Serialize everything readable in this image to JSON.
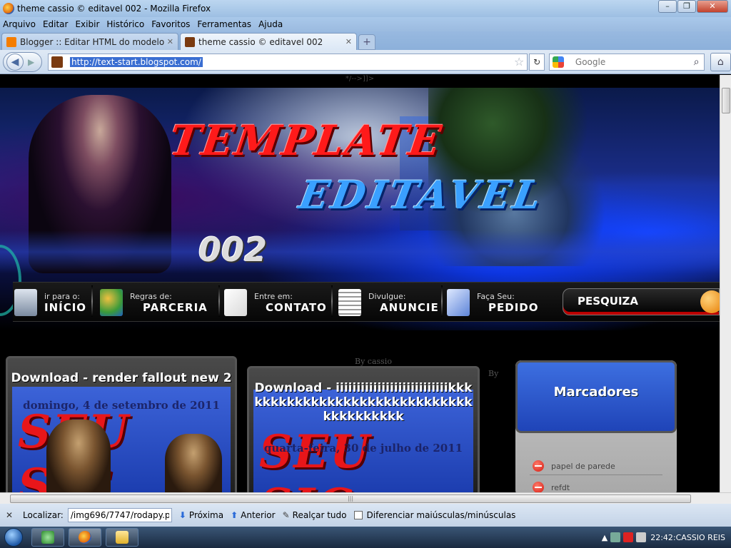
{
  "window": {
    "title": "theme cassio © editavel 002 - Mozilla Firefox"
  },
  "menu": [
    "Arquivo",
    "Editar",
    "Exibir",
    "Histórico",
    "Favoritos",
    "Ferramentas",
    "Ajuda"
  ],
  "tabs": [
    {
      "label": "Blogger :: Editar HTML do modelo",
      "active": false
    },
    {
      "label": "theme cassio © editavel 002",
      "active": true
    }
  ],
  "nav": {
    "url": "http://text-start.blogspot.com/",
    "search_placeholder": "Google"
  },
  "page": {
    "top_strip": "*/-->]]>",
    "banner": {
      "logo_line1": "TEMPLATE",
      "logo_line2": "EDITAVEL",
      "logo_line3": "002"
    },
    "nav_items": [
      {
        "small": "ir para o:",
        "big": "INÍCIO"
      },
      {
        "small": "Regras de:",
        "big": "PARCERIA"
      },
      {
        "small": "Entre em:",
        "big": "CONTATO"
      },
      {
        "small": "Divulgue:",
        "big": "ANUNCIE"
      },
      {
        "small": "Faça Seu:",
        "big": "PEDIDO"
      }
    ],
    "search_button": "PESQUIZA",
    "by1": "By cassio",
    "by2": "By",
    "posts": [
      {
        "title": "Download - render fallout new 2",
        "date": "domingo, 4 de setembro de 2011",
        "image_text": "SEU SIC"
      },
      {
        "title": "Download - iiiiiiiiiiiiiiiiiiiiiiiiiiikkkkkkkkkkkkkkkkkkkkkkkkkkkkkkkkkkkkkkkk",
        "date": "quarta-feira, 30 de julho de 2011",
        "image_text": "SEU SIC"
      }
    ],
    "sidebar": {
      "title": "Marcadores",
      "labels": [
        "papel de parede",
        "refdt"
      ]
    }
  },
  "findbar": {
    "label": "Localizar:",
    "value": "/img696/7747/rodapy.png",
    "next": "Próxima",
    "prev": "Anterior",
    "highlight": "Realçar tudo",
    "match_case": "Diferenciar maiúsculas/minúsculas"
  },
  "taskbar": {
    "clock": "22:42:CASSIO REIS"
  }
}
